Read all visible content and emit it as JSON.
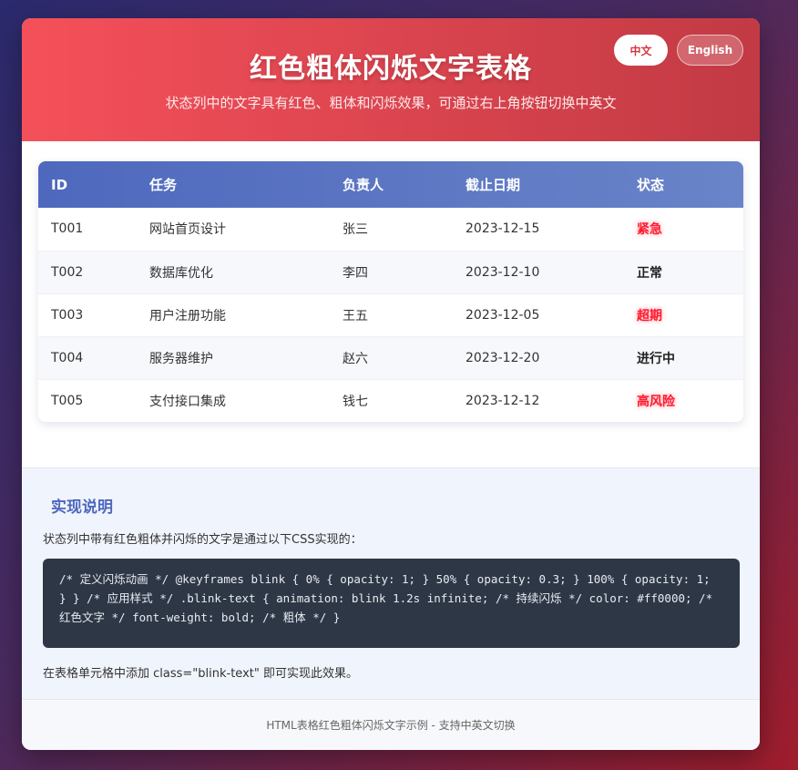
{
  "header": {
    "title": "红色粗体闪烁文字表格",
    "subtitle": "状态列中的文字具有红色、粗体和闪烁效果，可通过右上角按钮切换中英文",
    "lang_zh": "中文",
    "lang_en": "English"
  },
  "table": {
    "columns": [
      "ID",
      "任务",
      "负责人",
      "截止日期",
      "状态"
    ],
    "rows": [
      {
        "id": "T001",
        "task": "网站首页设计",
        "owner": "张三",
        "due": "2023-12-15",
        "status": "紧急"
      },
      {
        "id": "T002",
        "task": "数据库优化",
        "owner": "李四",
        "due": "2023-12-10",
        "status": "正常"
      },
      {
        "id": "T003",
        "task": "用户注册功能",
        "owner": "王五",
        "due": "2023-12-05",
        "status": "超期"
      },
      {
        "id": "T004",
        "task": "服务器维护",
        "owner": "赵六",
        "due": "2023-12-20",
        "status": "进行中"
      },
      {
        "id": "T005",
        "task": "支付接口集成",
        "owner": "钱七",
        "due": "2023-12-12",
        "status": "高风险"
      }
    ]
  },
  "notes": {
    "title": "实现说明",
    "intro": "状态列中带有红色粗体并闪烁的文字是通过以下CSS实现的：",
    "code": "/* 定义闪烁动画 */ @keyframes blink { 0% { opacity: 1; } 50% { opacity: 0.3; } 100% { opacity: 1; } } /* 应用样式 */ .blink-text { animation: blink 1.2s infinite; /* 持续闪烁 */ color: #ff0000; /* 红色文字 */ font-weight: bold; /* 粗体 */ }",
    "outro": "在表格单元格中添加 class=\"blink-text\" 即可实现此效果。"
  },
  "footer": {
    "text": "HTML表格红色粗体闪烁文字示例 - 支持中英文切换"
  },
  "colors": {
    "accent_red": "#ff1a2e",
    "header_blue": "#4e68bd"
  }
}
